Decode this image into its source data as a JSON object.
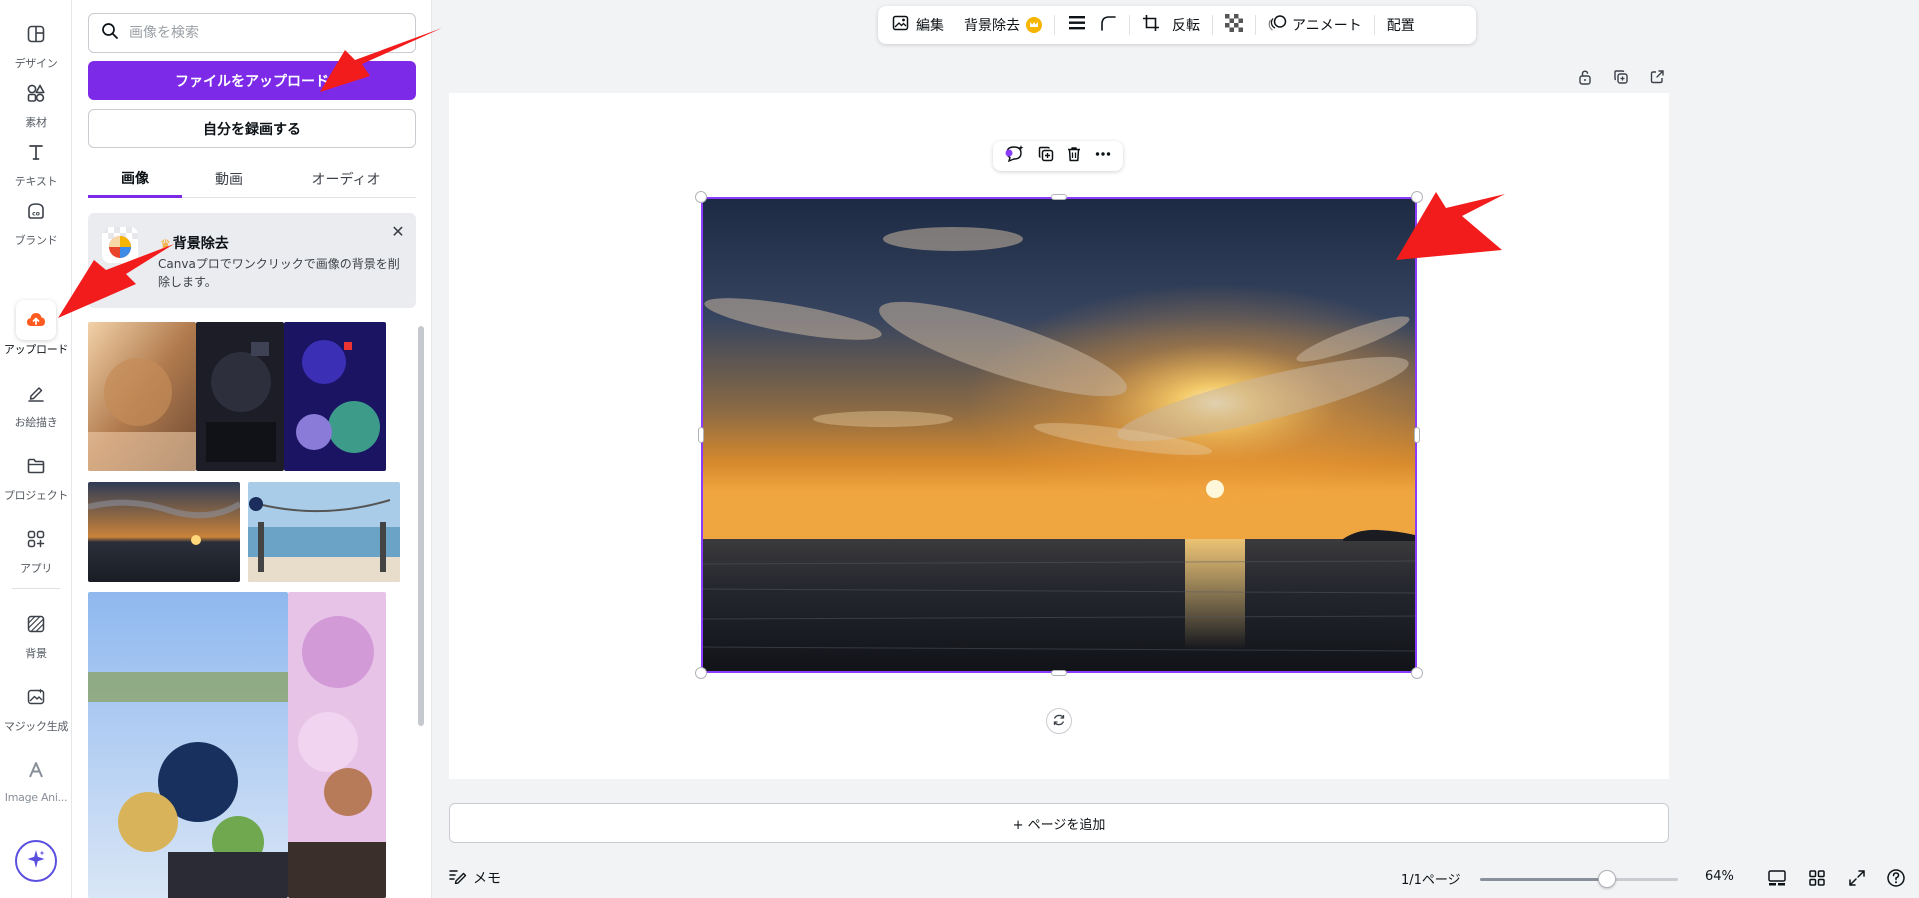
{
  "rail": {
    "items": [
      {
        "label": "デザイン",
        "icon": "layout-icon"
      },
      {
        "label": "素材",
        "icon": "shapes-icon"
      },
      {
        "label": "テキスト",
        "icon": "text-icon"
      },
      {
        "label": "ブランド",
        "icon": "brand-icon"
      },
      {
        "label": "アップロード",
        "icon": "cloud-upload-icon"
      },
      {
        "label": "お絵描き",
        "icon": "draw-icon"
      },
      {
        "label": "プロジェクト",
        "icon": "folder-icon"
      },
      {
        "label": "アプリ",
        "icon": "apps-icon"
      },
      {
        "label": "背景",
        "icon": "background-icon"
      },
      {
        "label": "マジック生成",
        "icon": "magic-media-icon"
      },
      {
        "label": "Image Ani...",
        "icon": "image-animate-icon"
      }
    ],
    "active_index": 4
  },
  "panel": {
    "search_placeholder": "画像を検索",
    "upload_button": "ファイルをアップロード",
    "record_button": "自分を録画する",
    "tabs": [
      "画像",
      "動画",
      "オーディオ"
    ],
    "active_tab": 0,
    "promo": {
      "title": "背景除去",
      "text": "Canvaプロでワンクリックで画像の背景を削除します。"
    }
  },
  "toolbar": {
    "edit": "編集",
    "bg_remove": "背景除去",
    "flip": "反転",
    "animate": "アニメート",
    "arrange": "配置"
  },
  "canvas": {
    "add_page": "+ ページを追加"
  },
  "bottom": {
    "memo": "メモ",
    "pages": "1/1ページ",
    "zoom": "64%",
    "zoom_fraction": 0.64
  },
  "colors": {
    "accent": "#7d2ae8",
    "selection": "#8b3dff",
    "annotation_arrow": "#f21c1c"
  }
}
